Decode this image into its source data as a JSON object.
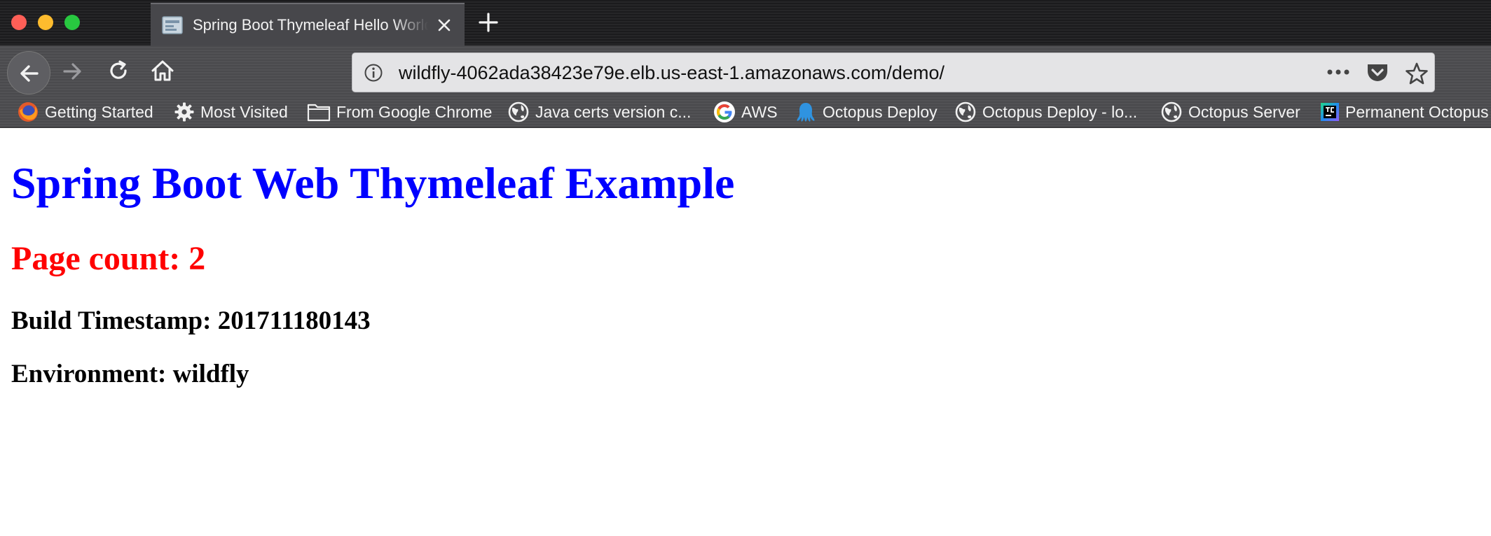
{
  "browser": {
    "tab": {
      "title": "Spring Boot Thymeleaf Hello World"
    },
    "url": "wildfly-4062ada38423e79e.elb.us-east-1.amazonaws.com/demo/",
    "bookmarks": [
      {
        "label": "Getting Started",
        "icon": "firefox-icon"
      },
      {
        "label": "Most Visited",
        "icon": "gear-icon"
      },
      {
        "label": "From Google Chrome",
        "icon": "folder-icon"
      },
      {
        "label": "Java certs version c...",
        "icon": "globe-icon"
      },
      {
        "label": "AWS",
        "icon": "google-icon"
      },
      {
        "label": "Octopus Deploy",
        "icon": "octopus-icon"
      },
      {
        "label": "Octopus Deploy - lo...",
        "icon": "globe-icon"
      },
      {
        "label": "Octopus Server",
        "icon": "globe-icon"
      },
      {
        "label": "Permanent Octopus",
        "icon": "teamcity-icon"
      }
    ]
  },
  "page": {
    "heading": "Spring Boot Web Thymeleaf Example",
    "page_count": "Page count: 2",
    "build_timestamp": "Build Timestamp: 201711180143",
    "environment": "Environment: wildfly"
  },
  "colors": {
    "heading": "#0000ff",
    "page_count": "#ff0000",
    "body_text": "#000000",
    "chrome_dark": "#1b1b1d",
    "chrome_toolbar": "#4e4e51",
    "active_tab": "#47474b"
  }
}
